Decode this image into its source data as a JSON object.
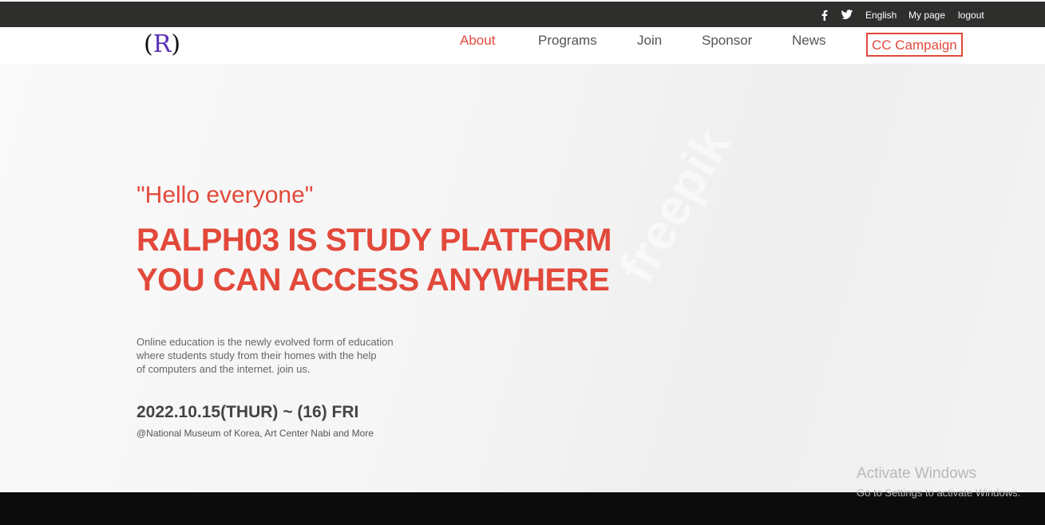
{
  "topbar": {
    "social": [
      "facebook-icon",
      "twitter-icon"
    ],
    "language": "English",
    "mypage": "My page",
    "logout": "logout"
  },
  "logo": {
    "open": "(",
    "letter": "R",
    "close": ")"
  },
  "nav": {
    "items": [
      "About",
      "Programs",
      "Join",
      "Sponsor",
      "News"
    ],
    "campaign": "CC Campaign",
    "active": "About"
  },
  "hero": {
    "greeting": "\"Hello everyone\"",
    "headline": [
      "RALPH03 IS STUDY PLATFORM",
      "YOU CAN ACCESS ANYWHERE"
    ],
    "description": [
      "Online education is the newly evolved form of education",
      "where students study from their homes with the help",
      "of computers and the internet. join us."
    ],
    "date": "2022.10.15(THUR) ~ (16) FRI",
    "venue": "@National Museum of Korea, Art Center Nabi and More"
  },
  "activation": {
    "title": "Activate Windows",
    "subtitle": "Go to Settings to activate Windows."
  },
  "colors": {
    "accent": "#e2493b",
    "topbar": "#2e2f2d",
    "logo_letter": "#5a2fb8"
  }
}
